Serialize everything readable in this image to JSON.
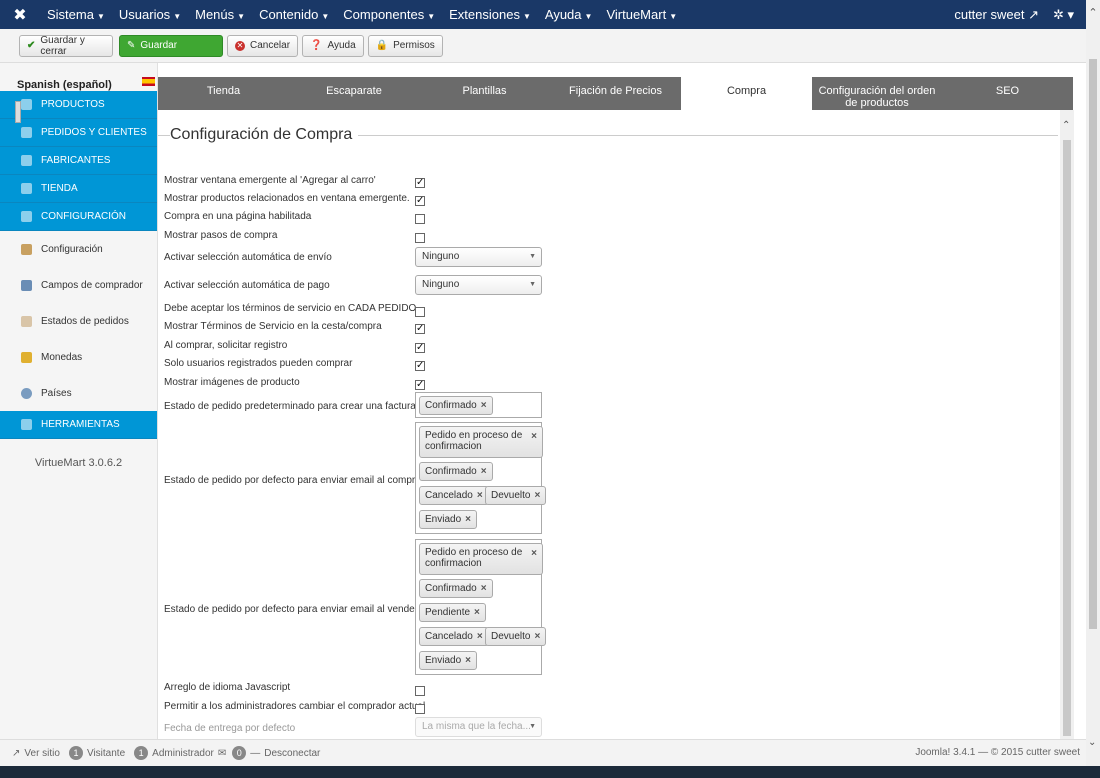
{
  "navbar": {
    "menus": [
      "Sistema",
      "Usuarios",
      "Menús",
      "Contenido",
      "Componentes",
      "Extensiones",
      "Ayuda",
      "VirtueMart"
    ],
    "user": "cutter sweet"
  },
  "toolbar": {
    "save_close": "Guardar y cerrar",
    "save": "Guardar",
    "cancel": "Cancelar",
    "help": "Ayuda",
    "permissions": "Permisos"
  },
  "sidebar": {
    "language": "Spanish (español)",
    "sections": [
      {
        "label": "PRODUCTOS",
        "type": "blue"
      },
      {
        "label": "PEDIDOS Y CLIENTES",
        "type": "blue"
      },
      {
        "label": "FABRICANTES",
        "type": "blue"
      },
      {
        "label": "TIENDA",
        "type": "blue"
      },
      {
        "label": "CONFIGURACIÓN",
        "type": "blue"
      },
      {
        "label": "Configuración",
        "type": "white"
      },
      {
        "label": "Campos de comprador",
        "type": "white"
      },
      {
        "label": "Estados de pedidos",
        "type": "white"
      },
      {
        "label": "Monedas",
        "type": "white"
      },
      {
        "label": "Países",
        "type": "white"
      },
      {
        "label": "HERRAMIENTAS",
        "type": "blue"
      }
    ],
    "version": "VirtueMart 3.0.6.2"
  },
  "tabs": [
    "Tienda",
    "Escaparate",
    "Plantillas",
    "Fijación de Precios",
    "Compra",
    "Configuración del orden de productos",
    "SEO"
  ],
  "active_tab": "Compra",
  "form": {
    "title": "Configuración de Compra",
    "checkboxes": [
      {
        "label": "Mostrar ventana emergente al 'Agregar al carro'",
        "checked": true
      },
      {
        "label": "Mostrar productos relacionados en ventana emergente.",
        "checked": true
      },
      {
        "label": "Compra en una página habilitada",
        "checked": false
      },
      {
        "label": "Mostrar pasos de compra",
        "checked": false
      }
    ],
    "auto_shipment": {
      "label": "Activar selección automática de envío",
      "value": "Ninguno"
    },
    "auto_payment": {
      "label": "Activar selección automática de pago",
      "value": "Ninguno"
    },
    "checkboxes2": [
      {
        "label": "Debe aceptar los términos de servicio en CADA PEDIDO",
        "checked": false
      },
      {
        "label": "Mostrar Términos de Servicio en la cesta/compra",
        "checked": true
      },
      {
        "label": "Al comprar, solicitar registro",
        "checked": true
      },
      {
        "label": "Solo usuarios registrados pueden comprar",
        "checked": true
      },
      {
        "label": "Mostrar imágenes de producto",
        "checked": true
      }
    ],
    "invoice_status": {
      "label": "Estado de pedido predeterminado para crear una factura",
      "chips": [
        "Confirmado"
      ]
    },
    "email_shopper": {
      "label": "Estado de pedido por defecto para enviar email al comprador",
      "chips": [
        "Pedido en proceso de confirmacion",
        "Confirmado",
        "Cancelado",
        "Devuelto",
        "Enviado"
      ]
    },
    "email_vendor": {
      "label": "Estado de pedido por defecto para enviar email al vendedor",
      "chips": [
        "Pedido en proceso de confirmacion",
        "Confirmado",
        "Pendiente",
        "Cancelado",
        "Devuelto",
        "Enviado"
      ]
    },
    "checkboxes3": [
      {
        "label": "Arreglo de idioma Javascript",
        "checked": false
      },
      {
        "label": "Permitir a los administradores cambiar el comprador actual",
        "checked": false
      }
    ],
    "delivery_date": {
      "label": "Fecha de entrega por defecto",
      "value": "La misma que la fecha..."
    }
  },
  "statusbar": {
    "view_site": "Ver sitio",
    "visitors_count": "1",
    "visitors_label": "Visitante",
    "admins_count": "1",
    "admins_label": "Administrador",
    "messages_count": "0",
    "logout": "Desconectar",
    "footer": "Joomla! 3.4.1 — © 2015 cutter sweet"
  },
  "colors": {
    "navbar": "#1a3867",
    "accent_blue": "#0096d6",
    "save_green": "#3fa732",
    "tab_bar": "#6b6b6b"
  }
}
